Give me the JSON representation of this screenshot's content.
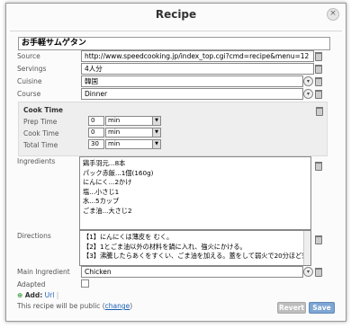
{
  "dialog": {
    "title": "Recipe",
    "close_glyph": "×"
  },
  "recipe_title": "お手軽サムゲタン",
  "fields": {
    "source_label": "Source",
    "source_value": "http://www.speedcooking.jp/index_top.cgi?cmd=recipe&menu=12",
    "servings_label": "Servings",
    "servings_value": "4人分",
    "cuisine_label": "Cuisine",
    "cuisine_value": "韓国",
    "course_label": "Course",
    "course_value": "Dinner"
  },
  "cook_time": {
    "heading": "Cook Time",
    "prep_label": "Prep Time",
    "prep_value": "0",
    "prep_unit": "min",
    "cook_label": "Cook Time",
    "cook_value": "0",
    "cook_unit": "min",
    "total_label": "Total Time",
    "total_value": "30",
    "total_unit": "min"
  },
  "ingredients": {
    "label": "Ingredients",
    "lines": [
      "鶏手羽元...8本",
      "パック赤飯...1個(160g)",
      "にんにく...2かけ",
      "塩...小さじ1",
      "水...5カップ",
      "ごま油...大さじ2"
    ]
  },
  "directions": {
    "label": "Directions",
    "lines": [
      "【1】にんにくは薄皮を むく。",
      "【2】1とごま油以外の材料を鍋に入れ、強火にかける。",
      "【3】沸騰したらあくをすくい、ごま油を加える。蓋をして弱火で20分ほど煮る。"
    ]
  },
  "main_ingredient": {
    "label": "Main Ingredient",
    "value": "Chicken"
  },
  "adapted": {
    "label": "Adapted",
    "checked": false
  },
  "add": {
    "label": "Add:",
    "link": "Url"
  },
  "public_note": {
    "text": "This recipe will be public (",
    "link": "change",
    "suffix": ")"
  },
  "buttons": {
    "revert": "Revert",
    "save": "Save"
  },
  "colors": {
    "save_bg": "#7ea6d4",
    "revert_bg": "#bdbdbd",
    "add_icon": "#3a9a3a"
  }
}
